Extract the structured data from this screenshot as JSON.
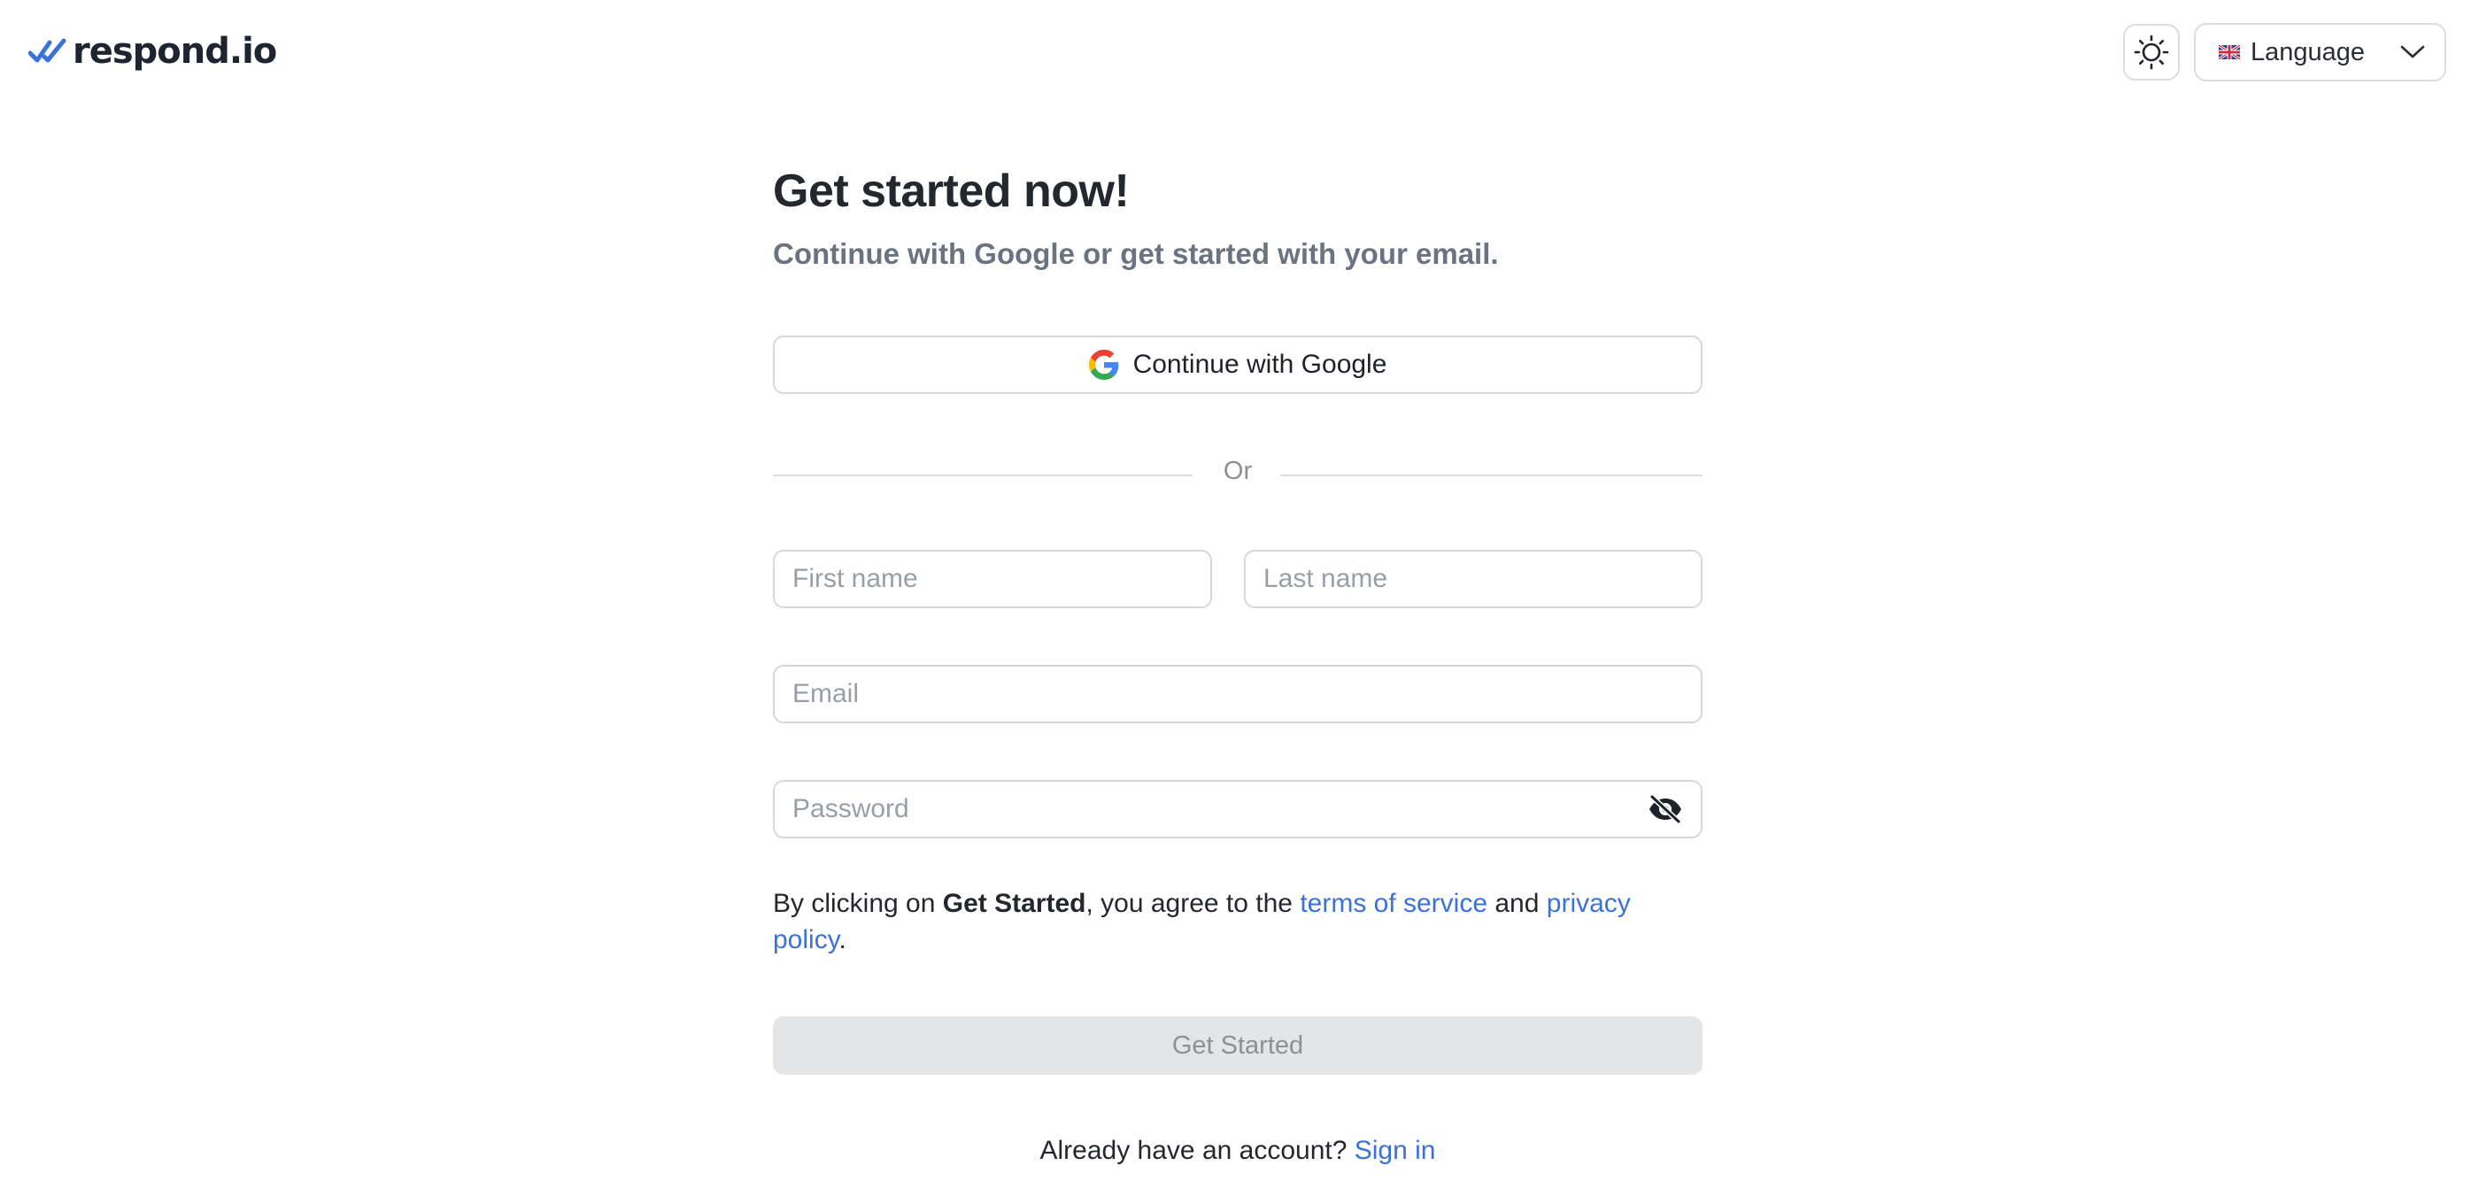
{
  "header": {
    "logo_text": "respond.io",
    "logo_color": "#3b72d9",
    "theme_toggle_icon": "sun-icon",
    "language": {
      "label": "Language",
      "flag": "uk-flag-icon",
      "chevron": "chevron-down-icon"
    }
  },
  "form": {
    "title": "Get started now!",
    "subtitle": "Continue with Google or get started with your email.",
    "google_button": "Continue with Google",
    "divider_text": "Or",
    "first_name_placeholder": "First name",
    "last_name_placeholder": "Last name",
    "email_placeholder": "Email",
    "password_placeholder": "Password",
    "password_toggle_icon": "eye-off-icon",
    "terms": {
      "prefix": "By clicking on ",
      "bold": "Get Started",
      "middle": ", you agree to the ",
      "tos_link": "terms of service",
      "and": " and ",
      "privacy_link": "privacy policy",
      "suffix": "."
    },
    "submit_label": "Get Started",
    "signin_prompt": "Already have an account? ",
    "signin_link": "Sign in"
  },
  "colors": {
    "accent": "#3b72d9",
    "text": "#24272d",
    "muted": "#6b7280",
    "border": "#d6d8dc",
    "disabled_bg": "#e4e5e7"
  }
}
